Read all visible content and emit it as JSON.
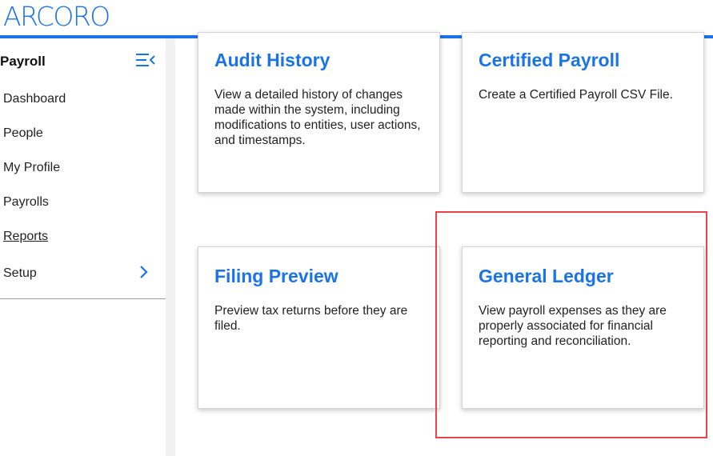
{
  "header": {
    "logo_text": "ARCORO"
  },
  "sidebar": {
    "title": "Payroll",
    "items": [
      {
        "label": "Dashboard"
      },
      {
        "label": "People"
      },
      {
        "label": "My Profile"
      },
      {
        "label": "Payrolls"
      },
      {
        "label": "Reports"
      },
      {
        "label": "Setup"
      }
    ]
  },
  "cards": [
    {
      "title": "Audit History",
      "description": "View a detailed history of changes made within the system, including modifications to entities, user actions, and timestamps."
    },
    {
      "title": "Certified Payroll",
      "description": "Create a Certified Payroll CSV File."
    },
    {
      "title": "Filing Preview",
      "description": "Preview tax returns before they are filed."
    },
    {
      "title": "General Ledger",
      "description": "View payroll expenses as they are properly associated for financial reporting and reconciliation."
    }
  ],
  "colors": {
    "brand": "#1a73e8",
    "highlight": "#e8454a"
  }
}
